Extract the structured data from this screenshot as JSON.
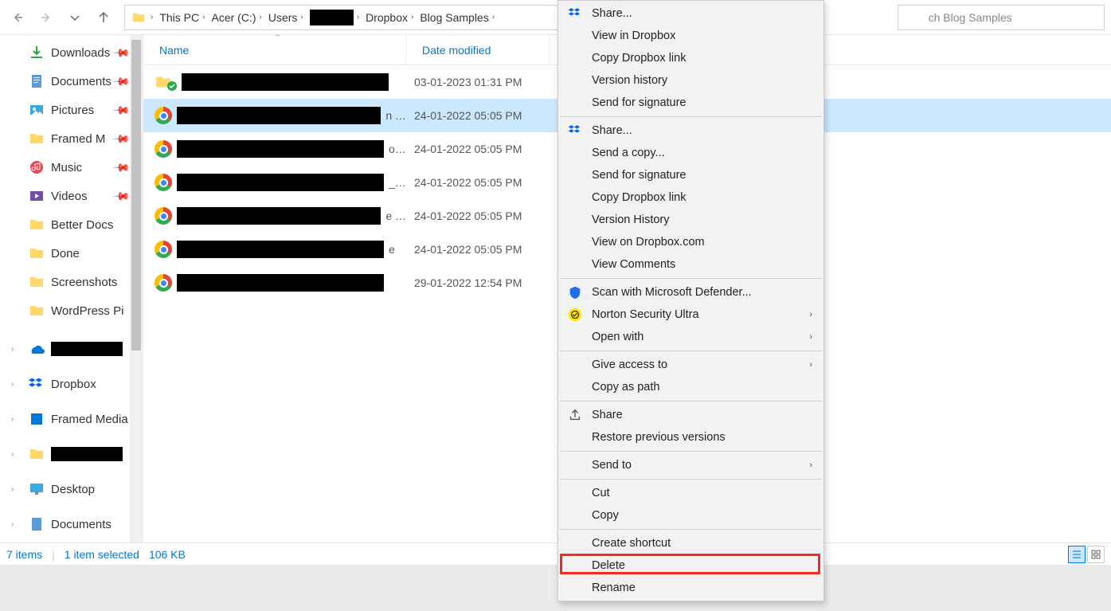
{
  "breadcrumb": {
    "items": [
      "This PC",
      "Acer (C:)",
      "Users",
      "",
      "Dropbox",
      "Blog Samples"
    ]
  },
  "search": {
    "placeholder": "Search Blog Samples"
  },
  "sidebar": {
    "quick": [
      {
        "label": "Downloads",
        "icon": "download",
        "pinned": true
      },
      {
        "label": "Documents",
        "icon": "document",
        "pinned": true
      },
      {
        "label": "Pictures",
        "icon": "pictures",
        "pinned": true
      },
      {
        "label": "Framed M",
        "icon": "folder",
        "pinned": true
      },
      {
        "label": "Music",
        "icon": "music",
        "pinned": true
      },
      {
        "label": "Videos",
        "icon": "videos",
        "pinned": true
      },
      {
        "label": "Better Docs",
        "icon": "folder",
        "pinned": false
      },
      {
        "label": "Done",
        "icon": "folder",
        "pinned": false
      },
      {
        "label": "Screenshots",
        "icon": "folder",
        "pinned": false
      },
      {
        "label": "WordPress Pi",
        "icon": "folder",
        "pinned": false
      }
    ],
    "tree": [
      {
        "label": "",
        "icon": "onedrive"
      },
      {
        "label": "Dropbox",
        "icon": "dropbox"
      },
      {
        "label": "Framed Media",
        "icon": "framed"
      },
      {
        "label": "",
        "icon": "folder"
      },
      {
        "label": "Desktop",
        "icon": "desktop"
      },
      {
        "label": "Documents",
        "icon": "document"
      }
    ]
  },
  "columns": {
    "name": "Name",
    "date": "Date modified"
  },
  "files": [
    {
      "type": "folder",
      "date": "03-01-2023 01:31 PM",
      "selected": false
    },
    {
      "type": "chrome",
      "date": "24-01-2022 05:05 PM",
      "selected": true,
      "trail": "n …"
    },
    {
      "type": "chrome",
      "date": "24-01-2022 05:05 PM",
      "selected": false,
      "trail": "o…"
    },
    {
      "type": "chrome",
      "date": "24-01-2022 05:05 PM",
      "selected": false,
      "trail": "_…"
    },
    {
      "type": "chrome",
      "date": "24-01-2022 05:05 PM",
      "selected": false,
      "trail": "e …"
    },
    {
      "type": "chrome",
      "date": "24-01-2022 05:05 PM",
      "selected": false,
      "trail": "e"
    },
    {
      "type": "chrome",
      "date": "29-01-2022 12:54 PM",
      "selected": false,
      "trail": ""
    }
  ],
  "context_menu": {
    "groups": [
      [
        {
          "label": "Share...",
          "icon": "dropbox"
        },
        {
          "label": "View in Dropbox"
        },
        {
          "label": "Copy Dropbox link"
        },
        {
          "label": "Version history"
        },
        {
          "label": "Send for signature"
        }
      ],
      [
        {
          "label": "Share...",
          "icon": "dropbox"
        },
        {
          "label": "Send a copy..."
        },
        {
          "label": "Send for signature"
        },
        {
          "label": "Copy Dropbox link"
        },
        {
          "label": "Version History"
        },
        {
          "label": "View on Dropbox.com"
        },
        {
          "label": "View Comments"
        }
      ],
      [
        {
          "label": "Scan with Microsoft Defender...",
          "icon": "shield"
        },
        {
          "label": "Norton Security Ultra",
          "icon": "norton",
          "submenu": true
        },
        {
          "label": "Open with",
          "submenu": true
        }
      ],
      [
        {
          "label": "Give access to",
          "submenu": true
        },
        {
          "label": "Copy as path"
        }
      ],
      [
        {
          "label": "Share",
          "icon": "share"
        },
        {
          "label": "Restore previous versions"
        }
      ],
      [
        {
          "label": "Send to",
          "submenu": true
        }
      ],
      [
        {
          "label": "Cut"
        },
        {
          "label": "Copy"
        }
      ],
      [
        {
          "label": "Create shortcut"
        },
        {
          "label": "Delete",
          "highlight": true
        },
        {
          "label": "Rename"
        }
      ]
    ]
  },
  "status": {
    "items": "7 items",
    "selected": "1 item selected",
    "size": "106 KB"
  }
}
